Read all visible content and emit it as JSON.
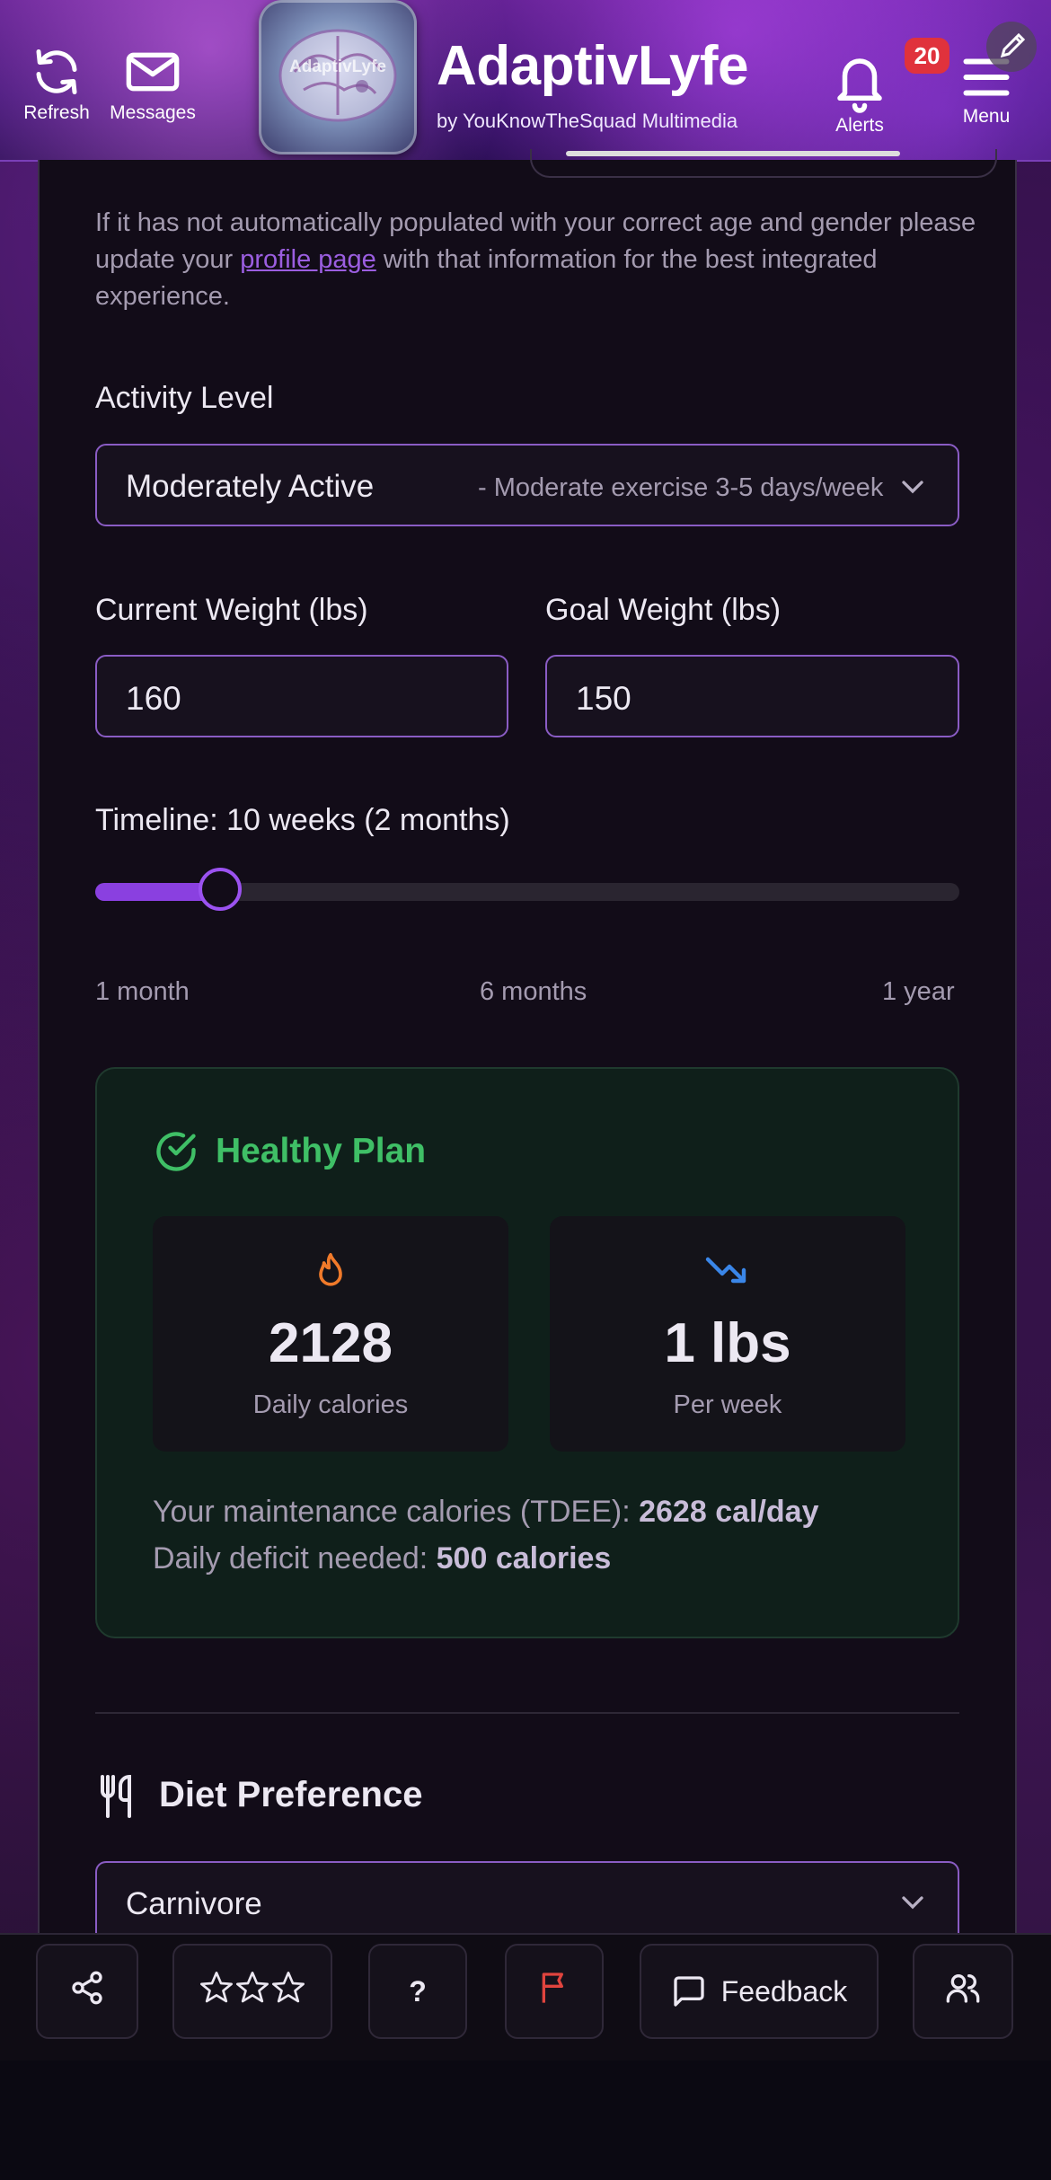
{
  "header": {
    "refresh_label": "Refresh",
    "messages_label": "Messages",
    "logo_text": "AdaptivLyfe",
    "app_title": "AdaptivLyfe",
    "app_subtitle": "by YouKnowTheSquad Multimedia",
    "alerts_label": "Alerts",
    "alerts_count": "20",
    "menu_label": "Menu"
  },
  "profile_notice": {
    "before": "If it has not automatically populated with your correct age and gender please update your ",
    "link": "profile page",
    "after": " with that information for the best integrated experience."
  },
  "activity": {
    "label": "Activity Level",
    "selected": "Moderately Active",
    "selected_desc": "- Moderate exercise 3-5 days/week"
  },
  "weights": {
    "current_label": "Current Weight (lbs)",
    "current_value": "160",
    "goal_label": "Goal Weight (lbs)",
    "goal_value": "150"
  },
  "timeline": {
    "label": "Timeline: 10 weeks (2 months)",
    "slider_fraction": 0.145,
    "min_label": "1 month",
    "mid_label": "6 months",
    "max_label": "1 year"
  },
  "plan": {
    "status": "Healthy Plan",
    "calories_value": "2128",
    "calories_label": "Daily calories",
    "rate_value": "1 lbs",
    "rate_label": "Per week",
    "tdee_prefix": "Your maintenance calories (TDEE): ",
    "tdee_value": "2628 cal/day",
    "deficit_prefix": "Daily deficit needed: ",
    "deficit_value": "500 calories"
  },
  "diet": {
    "heading": "Diet Preference",
    "selected": "Carnivore"
  },
  "bottom_bar": {
    "help_label": "?",
    "feedback_label": "Feedback"
  },
  "colors": {
    "accent_purple": "#8a5cc4",
    "healthy_green": "#3fbf66",
    "flame_orange": "#f07a2a",
    "trend_blue": "#3a86e8",
    "flag_red": "#e0443e"
  }
}
